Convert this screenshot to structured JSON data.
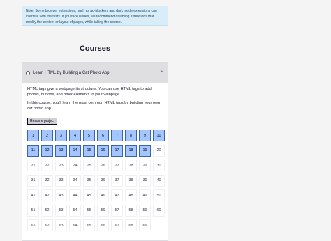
{
  "notice": {
    "text": "Note: Some browser extensions, such as ad-blockers and dark mode extensions can interfere with the tests. If you face issues, we recommend disabling extensions that modify the content or layout of pages, while taking the course."
  },
  "page_title": "Courses",
  "block": {
    "title": "Learn HTML by Building a Cat Photo App",
    "description_1": "HTML tags give a webpage its structure. You can use HTML tags to add photos, buttons, and other elements to your webpage.",
    "description_2": "In this course, you'll learn the most common HTML tags by building your own cat photo app.",
    "resume_label": "Resume project",
    "completed_steps": 19,
    "steps": [
      "1",
      "2",
      "3",
      "4",
      "5",
      "6",
      "7",
      "8",
      "9",
      "10",
      "11",
      "12",
      "13",
      "14",
      "15",
      "16",
      "17",
      "18",
      "19",
      "20",
      "21",
      "22",
      "23",
      "24",
      "25",
      "26",
      "27",
      "28",
      "29",
      "30",
      "31",
      "32",
      "33",
      "34",
      "35",
      "36",
      "37",
      "38",
      "39",
      "40",
      "41",
      "42",
      "43",
      "44",
      "45",
      "46",
      "47",
      "48",
      "49",
      "50",
      "51",
      "52",
      "53",
      "54",
      "55",
      "56",
      "57",
      "58",
      "59",
      "60",
      "61",
      "62",
      "63",
      "64",
      "65",
      "66",
      "67",
      "68",
      "69"
    ]
  },
  "icons": {
    "caret": "chevron-up-icon",
    "radio": "radio-icon"
  },
  "colors": {
    "completed": "#a4c6ff",
    "completed_border": "#3a63b8",
    "notice_bg": "#d9edf8"
  }
}
